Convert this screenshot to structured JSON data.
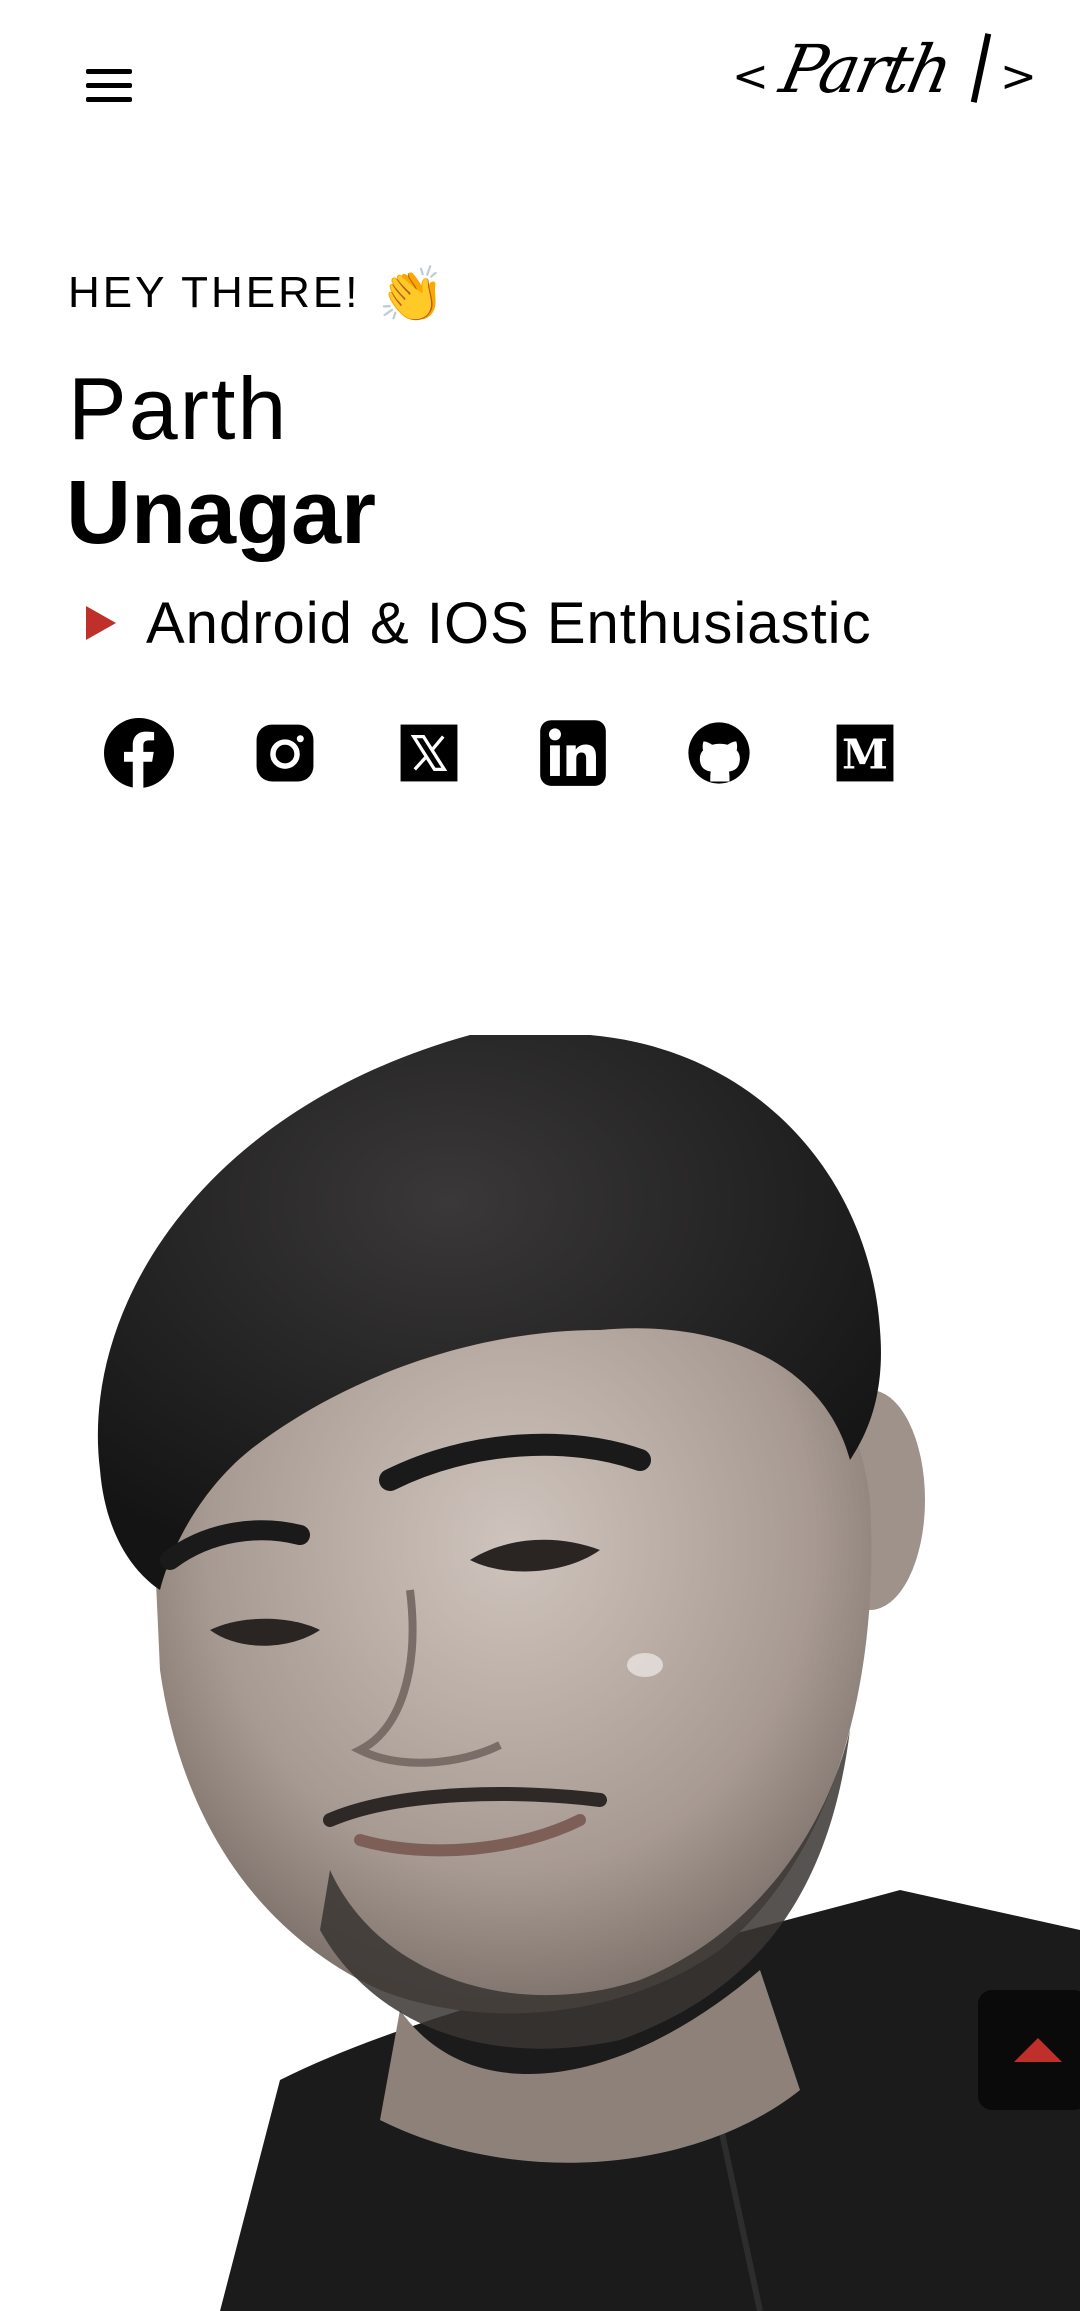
{
  "header": {
    "menu_icon": "hamburger-menu-icon",
    "logo": {
      "bracket_left": "<",
      "signature": "Parth",
      "bracket_right": ">"
    }
  },
  "hero": {
    "greeting": "HEY THERE!",
    "wave_emoji": "👏",
    "first_name": "Parth",
    "last_name": "Unagar",
    "tagline": "Android & IOS Enthusiastic",
    "tagline_icon": "play-triangle-icon",
    "accent_color": "#c0302a"
  },
  "social_links": [
    {
      "name": "facebook",
      "icon": "facebook-icon"
    },
    {
      "name": "instagram",
      "icon": "instagram-icon"
    },
    {
      "name": "x",
      "icon": "x-twitter-icon"
    },
    {
      "name": "linkedin",
      "icon": "linkedin-icon"
    },
    {
      "name": "github",
      "icon": "github-icon"
    },
    {
      "name": "medium",
      "icon": "medium-icon",
      "label": "M"
    }
  ],
  "portrait": {
    "description_icon": "profile-photo"
  },
  "scroll_top_button": {
    "icon": "arrow-up-triangle-icon",
    "bg": "#0a0a0a"
  }
}
